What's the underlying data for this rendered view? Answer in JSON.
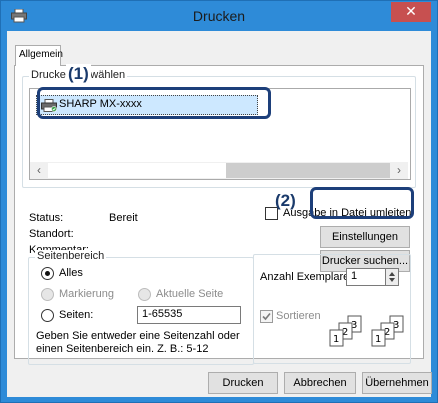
{
  "window": {
    "title": "Drucken",
    "close_glyph": "✕"
  },
  "tab": {
    "label": "Allgemein"
  },
  "printer_group": {
    "label": "Drucker auswählen",
    "items": [
      {
        "label": "SHARP MX-xxxx"
      }
    ],
    "scroll_left": "‹",
    "scroll_right": "›"
  },
  "callouts": {
    "c1": "(1)",
    "c2": "(2)"
  },
  "status": {
    "status_label": "Status:",
    "status_value": "Bereit",
    "location_label": "Standort:",
    "comment_label": "Kommentar:",
    "print_to_file_label": "Ausgabe in Datei umleiten",
    "settings_button": "Einstellungen",
    "find_printer_button": "Drucker suchen..."
  },
  "page_range": {
    "label": "Seitenbereich",
    "all": "Alles",
    "selection": "Markierung",
    "current_page": "Aktuelle Seite",
    "pages": "Seiten:",
    "pages_value": "1-65535",
    "hint_line1": "Geben Sie entweder eine Seitenzahl oder",
    "hint_line2": "einen Seitenbereich ein. Z. B.: 5-12"
  },
  "copies": {
    "count_label": "Anzahl Exemplare:",
    "count_value": "1",
    "collate_label": "Sortieren",
    "collate_checked": true
  },
  "footer": {
    "print_button": "Drucken",
    "cancel_button": "Abbrechen",
    "apply_button": "Übernehmen"
  },
  "colors": {
    "titlebar": "#2e8bd8",
    "selection": "#cde8ff",
    "callout": "#1d3f7a",
    "close": "#c75050"
  },
  "icons": {
    "app": "printer-icon",
    "printer": "printer-icon",
    "collate_a": "collate-pages-icon",
    "collate_b": "collate-pages-icon"
  }
}
